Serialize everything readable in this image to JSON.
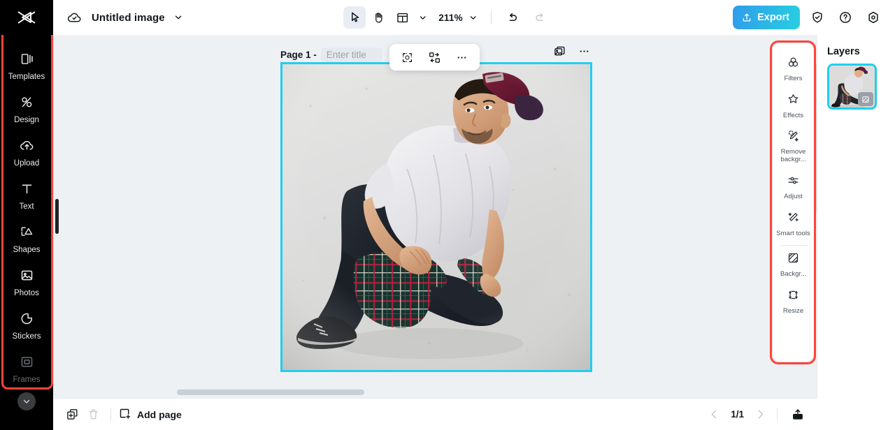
{
  "app": {
    "brand": "capcut-logo",
    "document_title": "Untitled image"
  },
  "toolbar": {
    "select_tool": "select-tool",
    "hand_tool": "hand-tool",
    "layout_tool": "layout-tool",
    "zoom_level": "211%",
    "undo": "undo",
    "redo": "redo",
    "export_label": "Export",
    "shield_icon": "shield-check-icon",
    "help_icon": "help-circle-icon",
    "settings_icon": "settings-gear-icon"
  },
  "sidebar": {
    "items": [
      {
        "label": "Templates",
        "icon": "templates-icon",
        "dim": false
      },
      {
        "label": "Design",
        "icon": "design-icon",
        "dim": false
      },
      {
        "label": "Upload",
        "icon": "upload-cloud-icon",
        "dim": false
      },
      {
        "label": "Text",
        "icon": "text-icon",
        "dim": false
      },
      {
        "label": "Shapes",
        "icon": "shapes-icon",
        "dim": false
      },
      {
        "label": "Photos",
        "icon": "photos-icon",
        "dim": false
      },
      {
        "label": "Stickers",
        "icon": "stickers-icon",
        "dim": false
      },
      {
        "label": "Frames",
        "icon": "frames-icon",
        "dim": true
      }
    ],
    "expand_more": "chevron-down-icon",
    "highlight_color": "#ff4338"
  },
  "canvas": {
    "page_label": "Page 1 -",
    "page_title_value": "",
    "page_title_placeholder": "Enter title",
    "duplicate_icon": "duplicate-image-icon",
    "more_icon": "more-options-icon",
    "selection_color": "#22cdee",
    "float_toolbar": [
      {
        "icon": "cutout-icon",
        "name": "cutout-tool"
      },
      {
        "icon": "replace-icon",
        "name": "replace-tool"
      },
      {
        "icon": "more-dots-icon",
        "name": "more-tools"
      }
    ]
  },
  "right_panel": {
    "items": [
      {
        "label": "Filters",
        "icon": "filters-icon"
      },
      {
        "label": "Effects",
        "icon": "effects-icon"
      },
      {
        "label": "Remove backgr...",
        "icon": "remove-background-icon"
      },
      {
        "label": "Adjust",
        "icon": "adjust-icon"
      },
      {
        "label": "Smart tools",
        "icon": "smart-tools-icon"
      }
    ],
    "items_secondary": [
      {
        "label": "Backgr...",
        "icon": "background-icon"
      },
      {
        "label": "Resize",
        "icon": "resize-icon"
      }
    ],
    "highlight_color": "#ff4338"
  },
  "layers": {
    "title": "Layers",
    "thumbnail_name": "layer-thumbnail-image",
    "selected": true
  },
  "bottombar": {
    "duplicate_page_icon": "duplicate-page-icon",
    "delete_page_icon": "delete-page-icon",
    "add_page_label": "Add page",
    "add_page_icon": "add-page-icon",
    "prev_icon": "chevron-left-icon",
    "next_icon": "chevron-right-icon",
    "page_counter": "1/1",
    "share_icon": "share-export-icon"
  }
}
